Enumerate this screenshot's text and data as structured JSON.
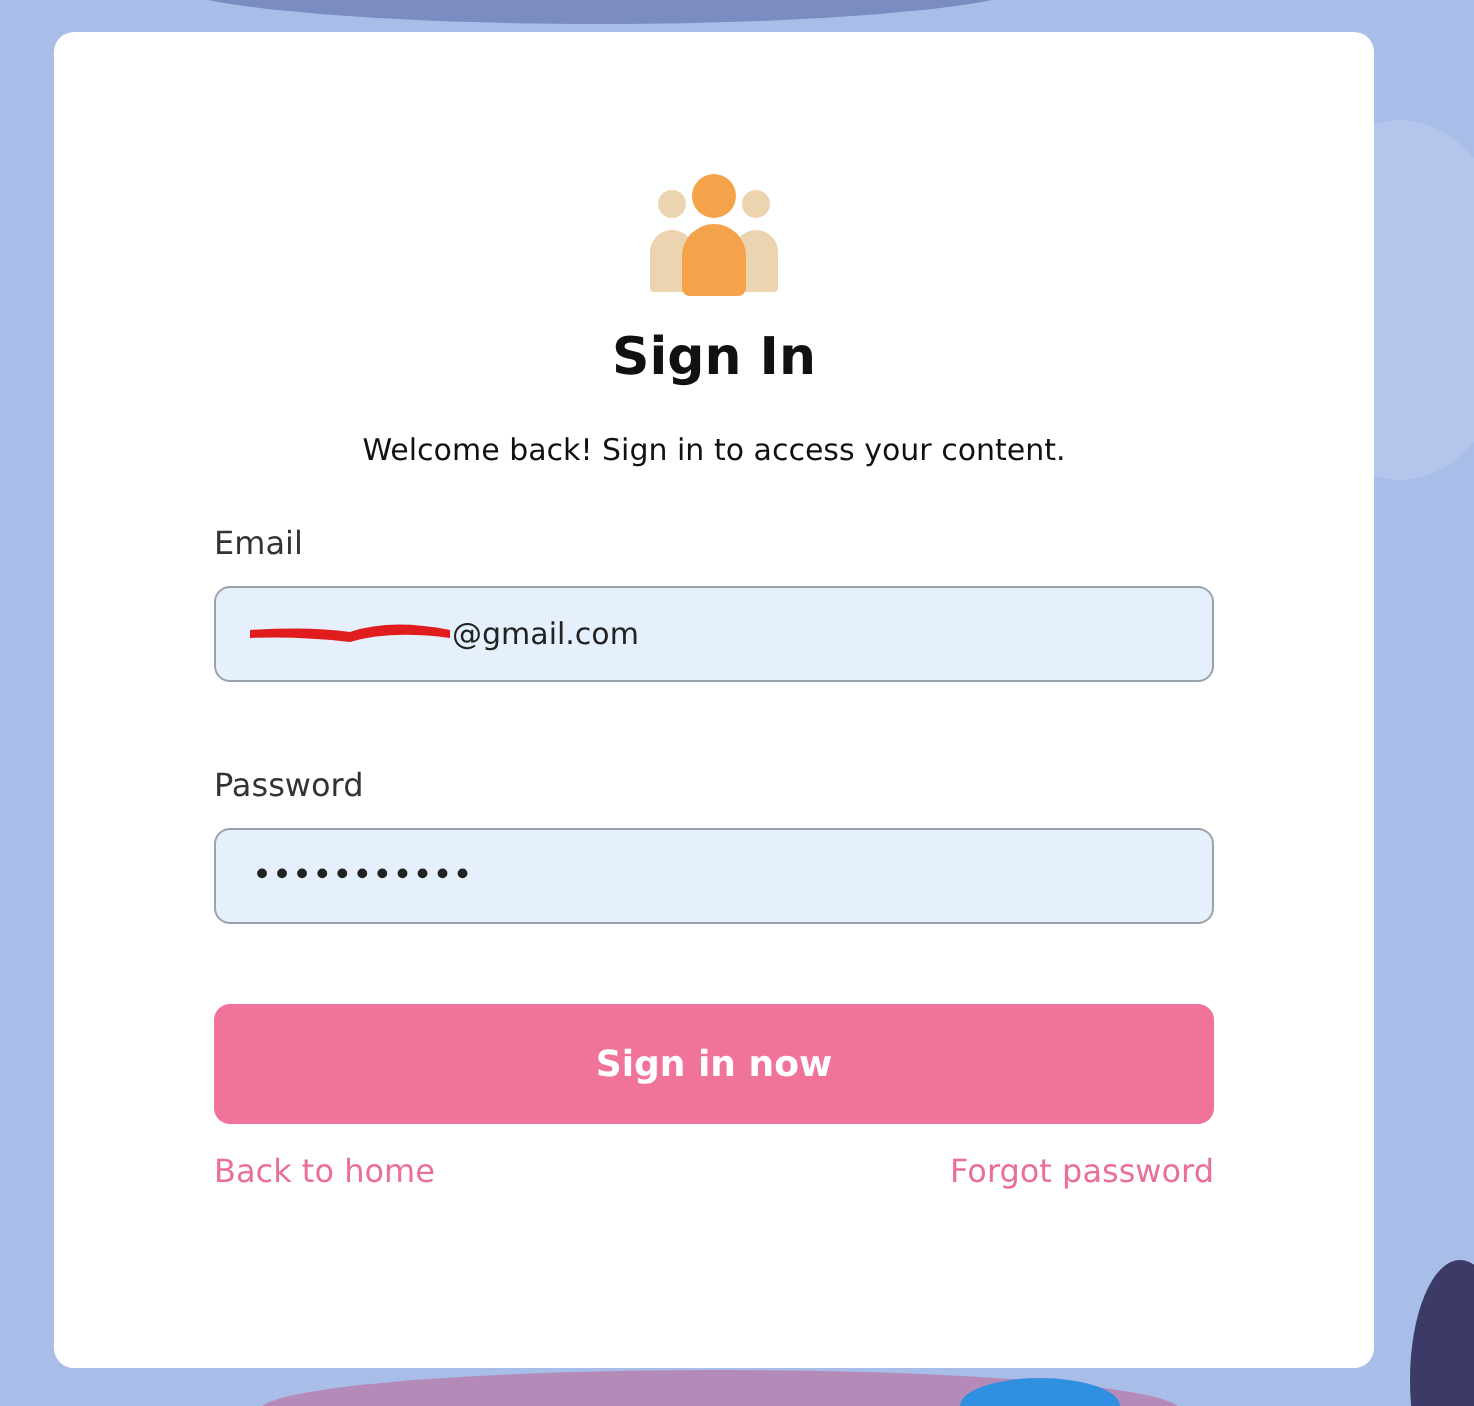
{
  "title": "Sign In",
  "subtitle": "Welcome back! Sign in to access your content.",
  "fields": [
    {
      "label": "Email",
      "value": "@gmail.com",
      "redacted": true,
      "kind": "text"
    },
    {
      "label": "Password",
      "value": "•••••••••••",
      "kind": "password"
    }
  ],
  "submit": "Sign in now",
  "links": [
    "Back to home",
    "Forgot password"
  ]
}
